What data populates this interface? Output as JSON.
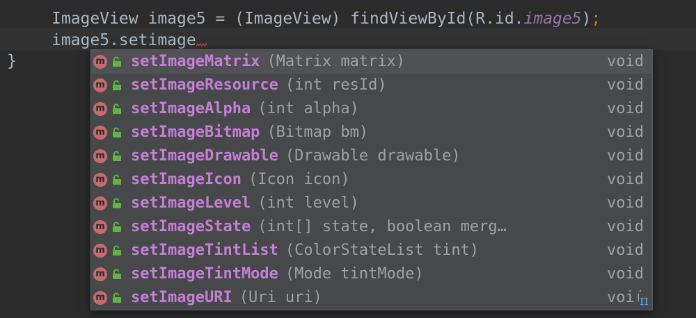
{
  "code": {
    "line1": {
      "prefix": "ImageView image5 = (ImageView) findViewById(R.id.",
      "field": "image5",
      "suffix": ")",
      "semicolon": ";"
    },
    "line2": "image5.setimage",
    "line3": "}"
  },
  "completion": {
    "items": [
      {
        "name": "setImageMatrix",
        "params": "(Matrix matrix)",
        "type": "void"
      },
      {
        "name": "setImageResource",
        "params": "(int resId)",
        "type": "void"
      },
      {
        "name": "setImageAlpha",
        "params": "(int alpha)",
        "type": "void"
      },
      {
        "name": "setImageBitmap",
        "params": "(Bitmap bm)",
        "type": "void"
      },
      {
        "name": "setImageDrawable",
        "params": "(Drawable drawable)",
        "type": "void"
      },
      {
        "name": "setImageIcon",
        "params": "(Icon icon)",
        "type": "void"
      },
      {
        "name": "setImageLevel",
        "params": "(int level)",
        "type": "void"
      },
      {
        "name": "setImageState",
        "params": "(int[] state, boolean merg…",
        "type": "void"
      },
      {
        "name": "setImageTintList",
        "params": "(ColorStateList tint)",
        "type": "void"
      },
      {
        "name": "setImageTintMode",
        "params": "(Mode tintMode)",
        "type": "void"
      },
      {
        "name": "setImageURI",
        "params": "(Uri uri)",
        "type": "voi("
      }
    ],
    "icon_letter": "m",
    "pi_symbol": "π"
  },
  "colors": {
    "background": "#2b2b2b",
    "popup_bg": "#46484a",
    "selected_bg": "#4f5154",
    "method_name": "#c57fd6",
    "method_icon": "#c56b6b",
    "lock_icon": "#62b543",
    "muted_text": "#9ea2a7"
  }
}
